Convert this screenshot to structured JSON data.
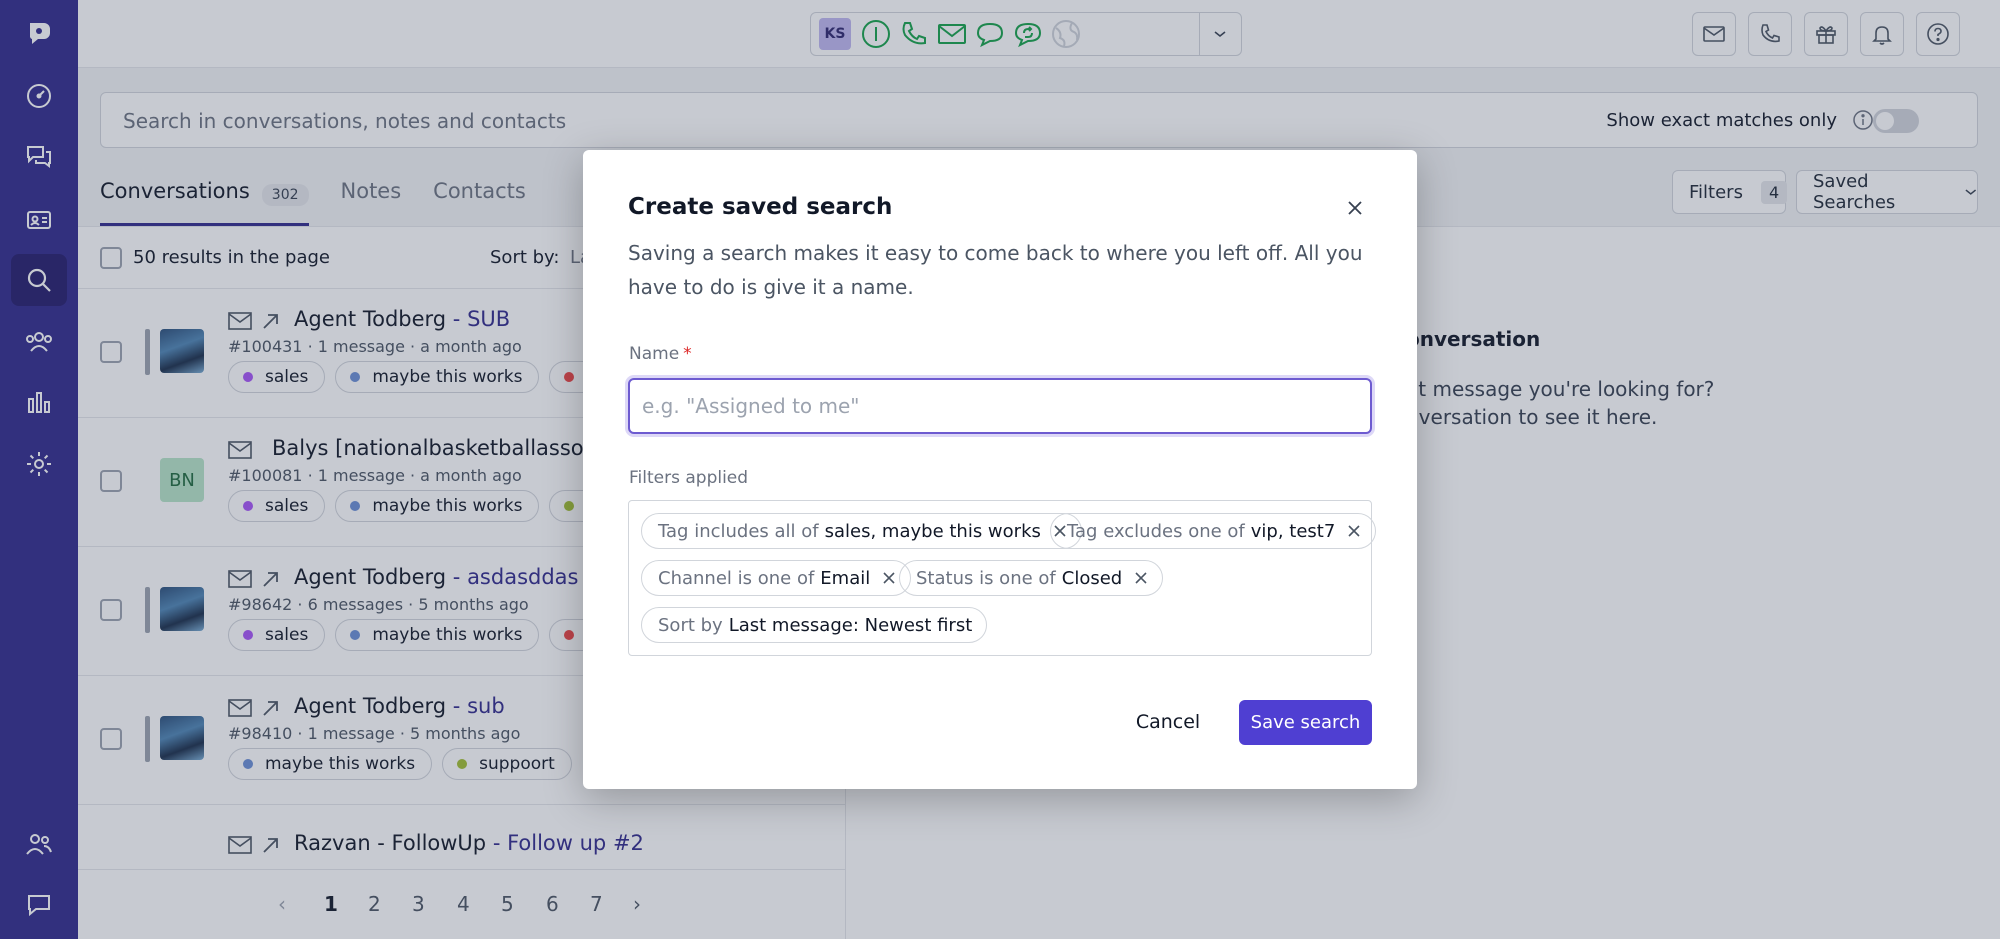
{
  "theme": {
    "sidebar": "#312a8c",
    "accent": "#4f3fd2",
    "channel_green": "#16a34a"
  },
  "sidebar": {
    "items": [
      {
        "icon": "logo-icon"
      },
      {
        "icon": "dashboard-icon"
      },
      {
        "icon": "conversations-icon"
      },
      {
        "icon": "contacts-card-icon"
      },
      {
        "icon": "search-icon",
        "active": true
      },
      {
        "icon": "team-icon"
      },
      {
        "icon": "reports-icon"
      },
      {
        "icon": "settings-icon"
      },
      {
        "icon": "users-icon"
      },
      {
        "icon": "chat-icon"
      }
    ]
  },
  "topbar": {
    "avatar_initials": "KS",
    "channels": [
      "availability-icon",
      "phone-icon",
      "email-icon",
      "chat-icon",
      "sync-chat-icon",
      "globe-icon"
    ],
    "right_icons": [
      "mail-icon",
      "phone-icon",
      "gift-icon",
      "bell-icon",
      "help-icon"
    ]
  },
  "search": {
    "placeholder": "Search in conversations, notes and contacts",
    "exact_label": "Show exact matches only",
    "exact_enabled": false
  },
  "tabs": [
    {
      "label": "Conversations",
      "count": "302",
      "active": true
    },
    {
      "label": "Notes"
    },
    {
      "label": "Contacts"
    }
  ],
  "toolbar": {
    "filters_label": "Filters",
    "filters_count": "4",
    "saved_searches_label": "Saved Searches"
  },
  "list": {
    "results_label": "50 results in the page",
    "sort_label": "Sort by:",
    "sort_value": "La",
    "rows": [
      {
        "name": "Agent Todberg",
        "sep": " - ",
        "subject": "SUB",
        "meta": "#100431 · 1 message · a month ago",
        "tags": [
          {
            "label": "sales",
            "color": "#a855f7"
          },
          {
            "label": "maybe this works",
            "color": "#6b8fd6"
          },
          {
            "label": "",
            "color": "#ef4444"
          }
        ]
      },
      {
        "name": "Balys [nationalbasketballassociat",
        "sep": "",
        "subject": "",
        "meta": "#100081 · 1 message · a month ago",
        "initials": "BN",
        "tags": [
          {
            "label": "sales",
            "color": "#a855f7"
          },
          {
            "label": "maybe this works",
            "color": "#6b8fd6"
          },
          {
            "label": "",
            "color": "#a3c033"
          }
        ]
      },
      {
        "name": "Agent Todberg",
        "sep": " - ",
        "subject": "asdasddas",
        "meta": "#98642 · 6 messages · 5 months ago",
        "tags": [
          {
            "label": "sales",
            "color": "#a855f7"
          },
          {
            "label": "maybe this works",
            "color": "#6b8fd6"
          },
          {
            "label": "",
            "color": "#ef4444"
          }
        ]
      },
      {
        "name": "Agent Todberg",
        "sep": " - ",
        "subject": "sub",
        "meta": "#98410 · 1 message · 5 months ago",
        "tags": [
          {
            "label": "maybe this works",
            "color": "#6b8fd6"
          },
          {
            "label": "suppoort",
            "color": "#a3c033"
          }
        ]
      },
      {
        "name": "Razvan - FollowUp",
        "sep": " - ",
        "subject": "Follow up #2",
        "meta": "",
        "tags": []
      }
    ]
  },
  "pager": {
    "pages": [
      "1",
      "2",
      "3",
      "4",
      "5",
      "6",
      "7"
    ],
    "current": "1",
    "prev": "‹",
    "next": "›"
  },
  "right_panel": {
    "title": "onversation",
    "line1": "at message you're looking for?",
    "line2": "nversation to see it here."
  },
  "modal": {
    "title": "Create saved search",
    "description": "Saving a search makes it easy to come back to where you left off. All you have to do is give it a name.",
    "name_label": "Name",
    "required_mark": "*",
    "name_placeholder": "e.g. \"Assigned to me\"",
    "name_value": "",
    "filters_label": "Filters applied",
    "chips": [
      {
        "key": "Tag includes all of",
        "value": "sales, maybe this works",
        "removable": true
      },
      {
        "key": "Tag excludes one of",
        "value": "vip, test7",
        "removable": true
      },
      {
        "key": "Channel is one of",
        "value": "Email",
        "removable": true
      },
      {
        "key": "Status is one of",
        "value": "Closed",
        "removable": true
      },
      {
        "key": "Sort by",
        "value": "Last message: Newest first",
        "removable": false
      }
    ],
    "cancel_label": "Cancel",
    "save_label": "Save search"
  }
}
